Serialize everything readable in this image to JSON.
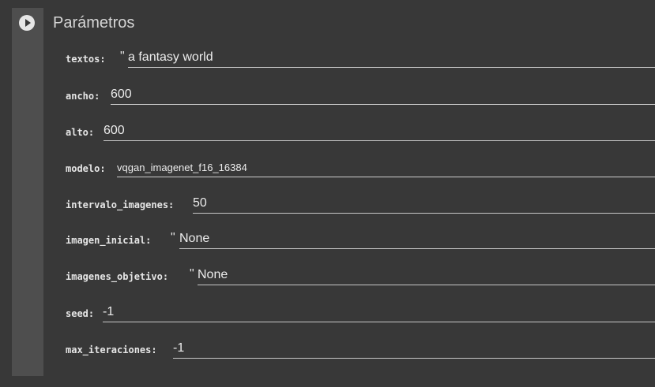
{
  "form": {
    "title": "Parámetros"
  },
  "fields": [
    {
      "label": "textos:",
      "quote": "\"",
      "value": "a fantasy world"
    },
    {
      "label": "ancho:",
      "quote": "",
      "value": "600"
    },
    {
      "label": "alto:",
      "quote": "",
      "value": "600"
    },
    {
      "label": "modelo:",
      "quote": "",
      "value": "vqgan_imagenet_f16_16384"
    },
    {
      "label": "intervalo_imagenes:",
      "quote": "",
      "value": "50"
    },
    {
      "label": "imagen_inicial:",
      "quote": "\"",
      "value": "None"
    },
    {
      "label": "imagenes_objetivo:",
      "quote": "\"",
      "value": "None"
    },
    {
      "label": "seed:",
      "quote": "",
      "value": "-1"
    },
    {
      "label": "max_iteraciones:",
      "quote": "",
      "value": "-1"
    }
  ],
  "colors": {
    "background": "#383838",
    "gutter": "#4e4e4e",
    "text": "#e6e6e6",
    "underline": "#c8c8c8"
  },
  "icons": {
    "run": "play-circle-icon"
  }
}
